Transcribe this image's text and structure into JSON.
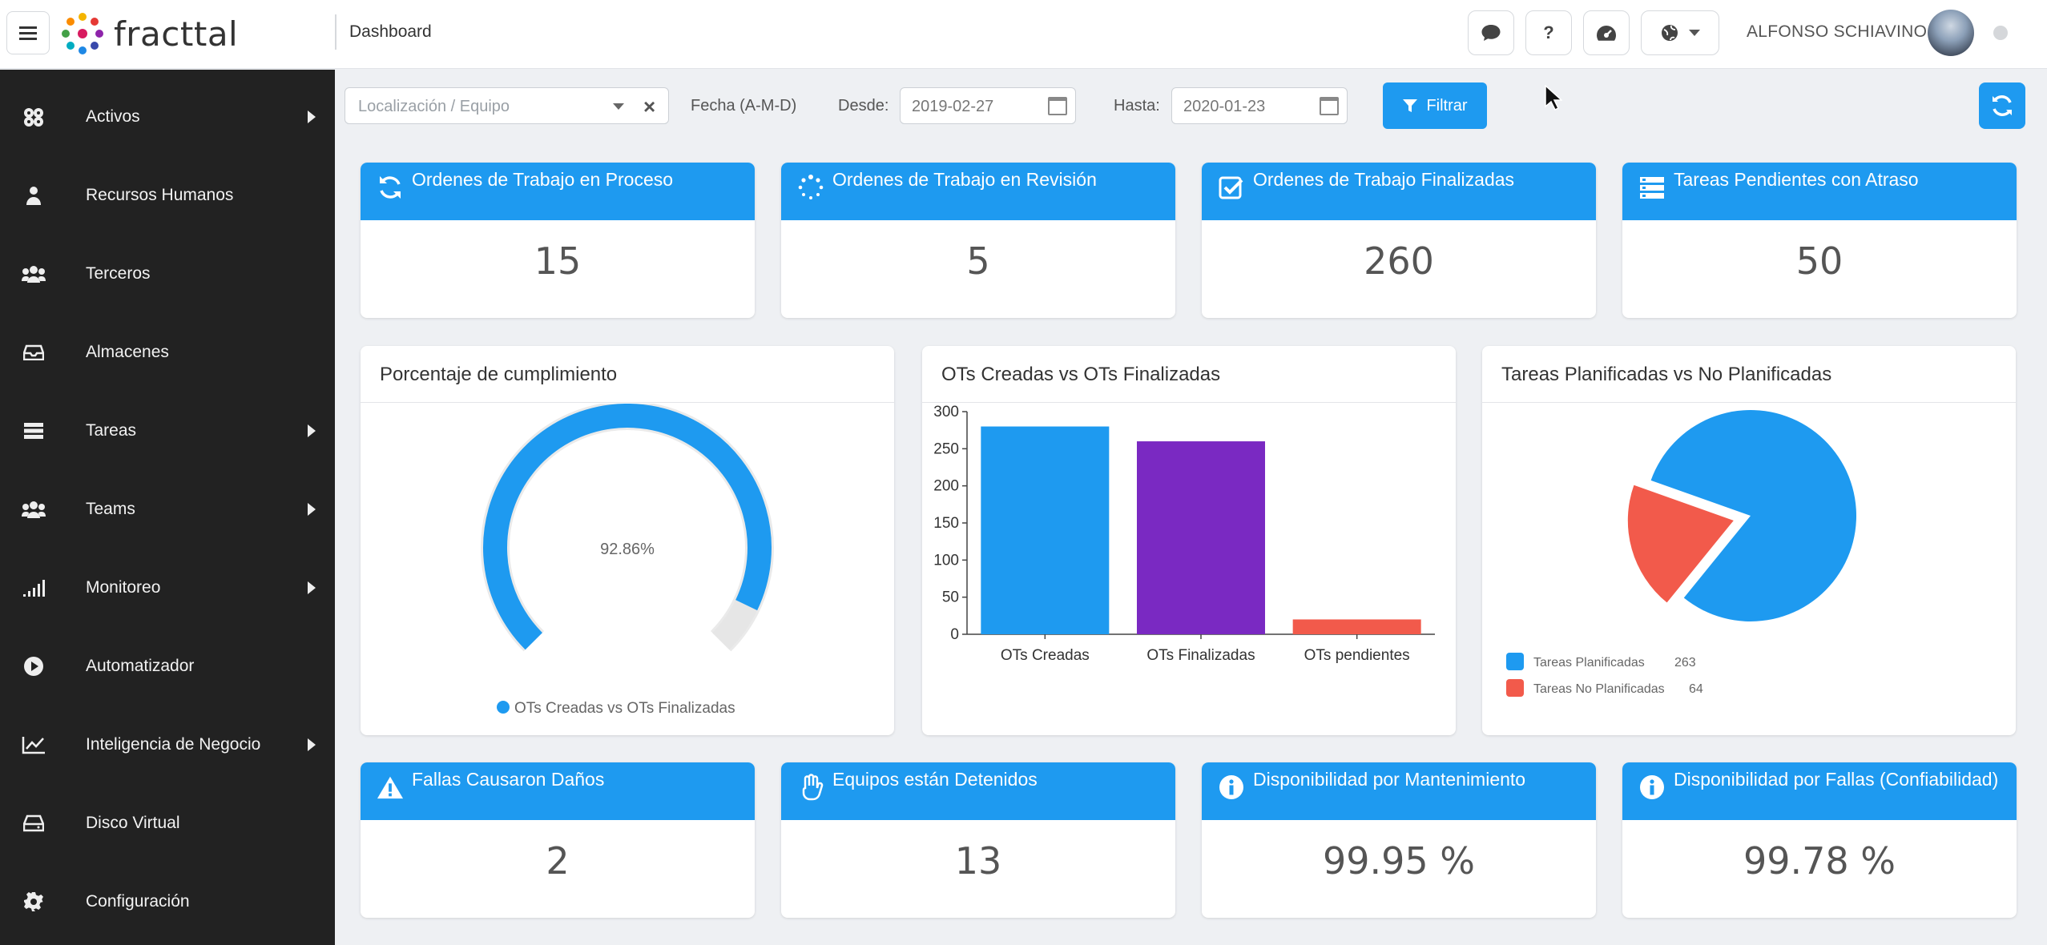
{
  "header": {
    "logo_text": "fracttal",
    "breadcrumb": "Dashboard",
    "help_label": "?",
    "user_name": "ALFONSO SCHIAVINO"
  },
  "sidebar": {
    "items": [
      {
        "label": "Activos",
        "icon": "assets-icon",
        "has_submenu": true
      },
      {
        "label": "Recursos Humanos",
        "icon": "person-icon",
        "has_submenu": false
      },
      {
        "label": "Terceros",
        "icon": "group-icon",
        "has_submenu": false
      },
      {
        "label": "Almacenes",
        "icon": "inbox-icon",
        "has_submenu": false
      },
      {
        "label": "Tareas",
        "icon": "server-icon",
        "has_submenu": true
      },
      {
        "label": "Teams",
        "icon": "group-icon",
        "has_submenu": true
      },
      {
        "label": "Monitoreo",
        "icon": "signal-icon",
        "has_submenu": true
      },
      {
        "label": "Automatizador",
        "icon": "play-circle-icon",
        "has_submenu": false
      },
      {
        "label": "Inteligencia de Negocio",
        "icon": "line-chart-icon",
        "has_submenu": true
      },
      {
        "label": "Disco Virtual",
        "icon": "hard-drive-icon",
        "has_submenu": false
      },
      {
        "label": "Configuración",
        "icon": "gear-icon",
        "has_submenu": false
      }
    ]
  },
  "filters": {
    "location_placeholder": "Localización / Equipo",
    "date_format_label": "Fecha (A-M-D)",
    "from_label": "Desde:",
    "from_value": "2019-02-27",
    "to_label": "Hasta:",
    "to_value": "2020-01-23",
    "filter_button": "Filtrar"
  },
  "kpis_top": [
    {
      "title": "Ordenes de Trabajo en Proceso",
      "value": "15",
      "icon": "sync-icon"
    },
    {
      "title": "Ordenes de Trabajo en Revisión",
      "value": "5",
      "icon": "spinner-icon"
    },
    {
      "title": "Ordenes de Trabajo Finalizadas",
      "value": "260",
      "icon": "check-square-icon"
    },
    {
      "title": "Tareas Pendientes con Atraso",
      "value": "50",
      "icon": "tasks-icon"
    }
  ],
  "kpis_bottom": [
    {
      "title": "Fallas Causaron Daños",
      "value": "2",
      "icon": "warning-icon"
    },
    {
      "title": "Equipos están Detenidos",
      "value": "13",
      "icon": "hand-icon"
    },
    {
      "title": "Disponibilidad por Mantenimiento",
      "value": "99.95 %",
      "icon": "info-icon"
    },
    {
      "title": "Disponibilidad por Fallas (Confiabilidad)",
      "value": "99.78 %",
      "icon": "info-icon"
    }
  ],
  "panels": {
    "gauge_title": "Porcentaje de cumplimiento",
    "bar_title": "OTs Creadas vs OTs Finalizadas",
    "pie_title": "Tareas Planificadas vs No Planificadas"
  },
  "chart_data": [
    {
      "type": "gauge",
      "title": "Porcentaje de cumplimiento",
      "value": 92.86,
      "value_label": "92.86%",
      "legend": [
        "OTs Creadas vs OTs Finalizadas"
      ],
      "colors": {
        "fill": "#1e9af0",
        "remainder": "#e6e6e6"
      }
    },
    {
      "type": "bar",
      "title": "OTs Creadas vs OTs Finalizadas",
      "categories": [
        "OTs Creadas",
        "OTs Finalizadas",
        "OTs pendientes"
      ],
      "values": [
        280,
        260,
        20
      ],
      "colors": [
        "#1e9af0",
        "#7a29c2",
        "#f25a4b"
      ],
      "ylim": [
        0,
        300
      ],
      "yticks": [
        0,
        50,
        100,
        150,
        200,
        250,
        300
      ]
    },
    {
      "type": "pie",
      "title": "Tareas Planificadas vs No Planificadas",
      "slices": [
        {
          "label": "Tareas Planificadas",
          "value": 263,
          "color": "#1e9af0"
        },
        {
          "label": "Tareas No Planificadas",
          "value": 64,
          "color": "#f25a4b"
        }
      ],
      "legend_position": "bottom-left"
    }
  ]
}
